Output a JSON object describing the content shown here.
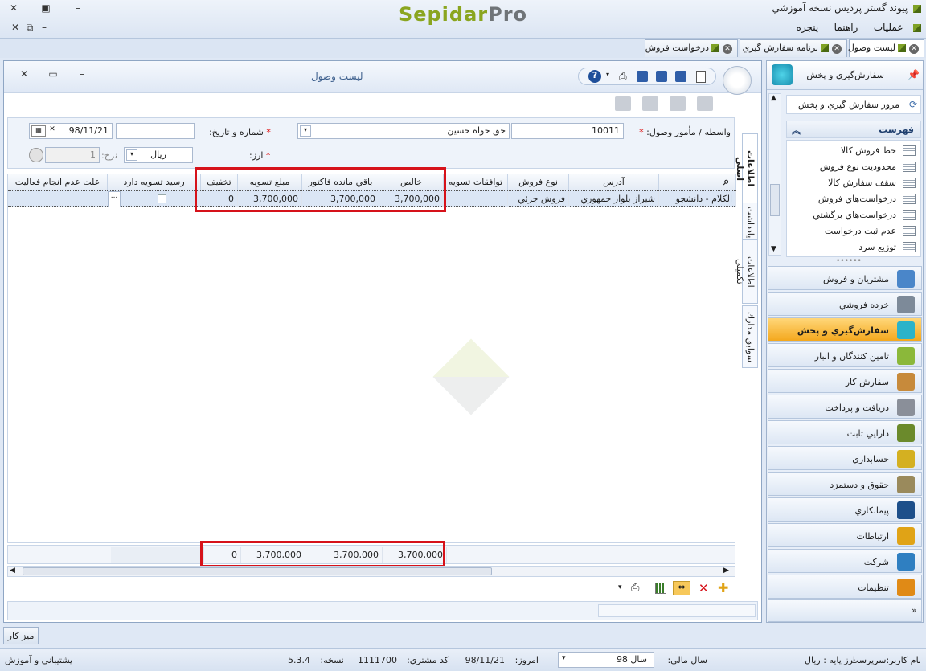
{
  "window": {
    "title": "پیوند گستر پردیس نسخه آموزشي",
    "brand_a": "Sepidar",
    "brand_b": "Pro"
  },
  "menu": [
    "عمليات",
    "راهنما",
    "پنجره"
  ],
  "tabs": [
    {
      "label": "ليست وصول"
    },
    {
      "label": "برنامه سفارش گيري"
    },
    {
      "label": "درخواست فروش"
    }
  ],
  "right_panel": {
    "title": "سفارش‌گيري و پخش",
    "overview": "مرور سفارش گيري و پخش",
    "list_header": "فهرست",
    "list_items": [
      "خط فروش كالا",
      "محدوديت نوع فروش",
      "سقف سفارش كالا",
      "درخواست‌هاي فروش",
      "درخواست‌هاي برگشتي",
      "عدم ثبت درخواست",
      "توزيع سرد"
    ],
    "nav": [
      {
        "label": "مشتريان و فروش",
        "color": "#4a86c9"
      },
      {
        "label": "خرده فروشي",
        "color": "#7d8a99"
      },
      {
        "label": "سفارش‌گيري و پخش",
        "color": "#2bb3c9",
        "active": true
      },
      {
        "label": "تامين كنندگان و انبار",
        "color": "#8bb83a"
      },
      {
        "label": "سفارش كار",
        "color": "#c78a3b"
      },
      {
        "label": "دريافت و پرداخت",
        "color": "#8a8f99"
      },
      {
        "label": "دارايي ثابت",
        "color": "#6b8a2c"
      },
      {
        "label": "حسابداري",
        "color": "#d4b021"
      },
      {
        "label": "حقوق و دستمزد",
        "color": "#9a8a5c"
      },
      {
        "label": "پيمانكاري",
        "color": "#1d4f8a"
      },
      {
        "label": "ارتباطات",
        "color": "#e0a316"
      },
      {
        "label": "شركت",
        "color": "#2f7fc1"
      },
      {
        "label": "تنظيمات",
        "color": "#e08a16"
      }
    ]
  },
  "content": {
    "title": "ليست وصول",
    "form": {
      "agent_label": "واسطه / مأمور وصول:",
      "agent_code": "10011",
      "agent_name": "حق خواه حسين",
      "number_date_label": "شماره و تاريخ:",
      "number": "",
      "date": "98/11/21",
      "currency_label": "ارز:",
      "currency": "ريال",
      "rate_label": "نرخ:",
      "rate": "1"
    },
    "side_tabs": [
      "اطلاعات اصلي",
      "يادداشت",
      "اطلاعات تكميلي",
      "سوابق مدارك"
    ],
    "columns": [
      "آدرس",
      "نوع فروش",
      "توافقات تسويه",
      "خالص",
      "باقي مانده فاكتور",
      "مبلغ تسويه",
      "تخفيف",
      "رسيد تسويه دارد",
      "علت عدم انجام فعاليت"
    ],
    "row": {
      "customer": "الكلام - دانشجو",
      "address": "شيراز بلوار جمهوري",
      "sale_type": "فروش جزئي",
      "agreement": "",
      "net": "3,700,000",
      "remaining": "3,700,000",
      "settlement": "3,700,000",
      "discount": "0",
      "reason": "..."
    },
    "totals": {
      "net": "3,700,000",
      "remaining": "3,700,000",
      "settlement": "3,700,000",
      "discount": "0"
    }
  },
  "taskbar": {
    "desk": "ميز كار"
  },
  "status": {
    "user_label": "نام كاربر:",
    "user": "سرپرست",
    "base_currency_label": "ارز پايه :",
    "base_currency": "ريال",
    "fiscal_year_label": "سال مالي:",
    "fiscal_year": "سال 98",
    "today_label": "امروز:",
    "today": "98/11/21",
    "customer_code_label": "كد مشتري:",
    "customer_code": "1111700",
    "version_label": "نسخه:",
    "version": "5.3.4",
    "support": "پشتيباني و آموزش"
  }
}
